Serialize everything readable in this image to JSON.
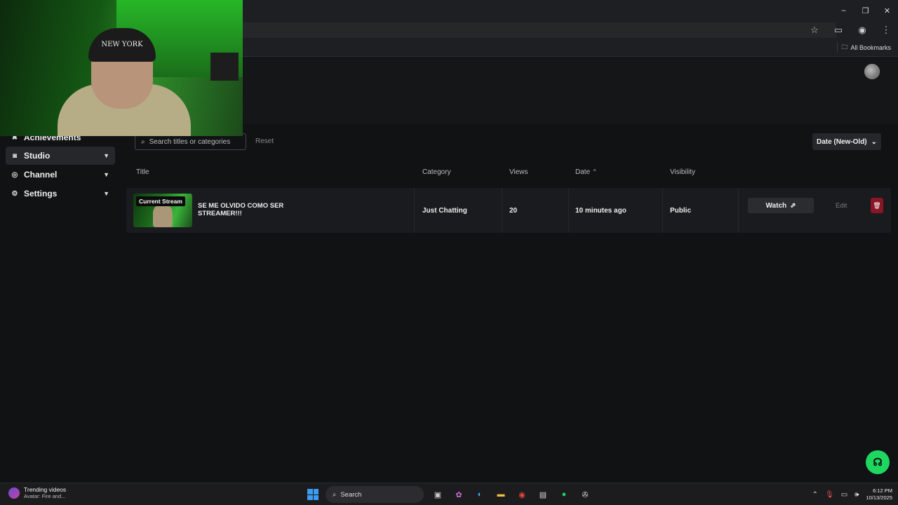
{
  "browser": {
    "window_controls": {
      "minimize": "–",
      "maximize": "❐",
      "close": "✕"
    },
    "bookmarks_label": "All Bookmarks",
    "addr_icons": [
      "star-icon",
      "cast-icon",
      "extension-icon",
      "menu-icon"
    ]
  },
  "sidebar": {
    "items": [
      {
        "label": "Achievements",
        "icon": "trophy-icon"
      },
      {
        "label": "Studio",
        "icon": "video-icon",
        "active": true
      },
      {
        "label": "Channel",
        "icon": "antenna-icon"
      },
      {
        "label": "Settings",
        "icon": "gear-icon"
      }
    ]
  },
  "toolbar": {
    "search_placeholder": "Search titles or categories",
    "reset_label": "Reset",
    "sort_label": "Date (New-Old)"
  },
  "table": {
    "headers": {
      "title": "Title",
      "category": "Category",
      "views": "Views",
      "date": "Date",
      "visibility": "Visibility"
    },
    "rows": [
      {
        "badge": "Current Stream",
        "title": "SE ME OLVIDO COMO SER STREAMER!!!",
        "category": "Just Chatting",
        "views": "20",
        "date": "10 minutes ago",
        "visibility": "Public",
        "watch_label": "Watch",
        "edit_label": "Edit"
      }
    ]
  },
  "webcam": {
    "cap_text": "NEW YORK"
  },
  "taskbar": {
    "news_title": "Trending videos",
    "news_sub": "Avatar: Fire and...",
    "search_label": "Search",
    "time": "6:12 PM",
    "date": "10/13/2025"
  },
  "colors": {
    "accent_green": "#1ed760",
    "delete_red": "#8a1526",
    "background": "#111214"
  }
}
